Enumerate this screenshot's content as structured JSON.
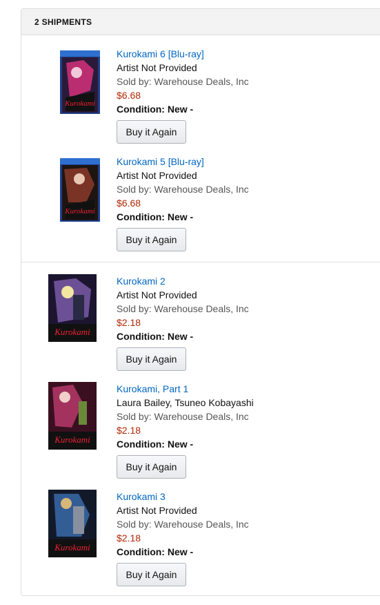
{
  "header": {
    "title": "2 SHIPMENTS"
  },
  "shipments": [
    {
      "items": [
        {
          "title": "Kurokami 6 [Blu-ray]",
          "artist": "Artist Not Provided",
          "seller": "Sold by: Warehouse Deals, Inc",
          "price": "$6.68",
          "condition": "Condition: New -",
          "button": "Buy it Again",
          "image_alt": "Kurokami 6 Blu-ray cover",
          "colors": {
            "accent": "#d4317a",
            "dark": "#2a1a3a"
          }
        },
        {
          "title": "Kurokami 5 [Blu-ray]",
          "artist": "Artist Not Provided",
          "seller": "Sold by: Warehouse Deals, Inc",
          "price": "$6.68",
          "condition": "Condition: New -",
          "button": "Buy it Again",
          "image_alt": "Kurokami 5 Blu-ray cover",
          "colors": {
            "accent": "#8a3a2a",
            "dark": "#1e1512"
          }
        }
      ]
    },
    {
      "items": [
        {
          "title": "Kurokami 2",
          "artist": "Artist Not Provided",
          "seller": "Sold by: Warehouse Deals, Inc",
          "price": "$2.18",
          "condition": "Condition: New -",
          "button": "Buy it Again",
          "image_alt": "Kurokami 2 DVD cover",
          "colors": {
            "accent": "#7a5aa8",
            "dark": "#1c1530"
          }
        },
        {
          "title": "Kurokami, Part 1",
          "artist": "Laura Bailey, Tsuneo Kobayashi",
          "seller": "Sold by: Warehouse Deals, Inc",
          "price": "$2.18",
          "condition": "Condition: New -",
          "button": "Buy it Again",
          "image_alt": "Kurokami Part 1 DVD cover",
          "colors": {
            "accent": "#b63a6a",
            "dark": "#3a1020"
          }
        },
        {
          "title": "Kurokami 3",
          "artist": "Artist Not Provided",
          "seller": "Sold by: Warehouse Deals, Inc",
          "price": "$2.18",
          "condition": "Condition: New -",
          "button": "Buy it Again",
          "image_alt": "Kurokami 3 DVD cover",
          "colors": {
            "accent": "#3a6aa8",
            "dark": "#121a2a"
          }
        }
      ]
    }
  ]
}
